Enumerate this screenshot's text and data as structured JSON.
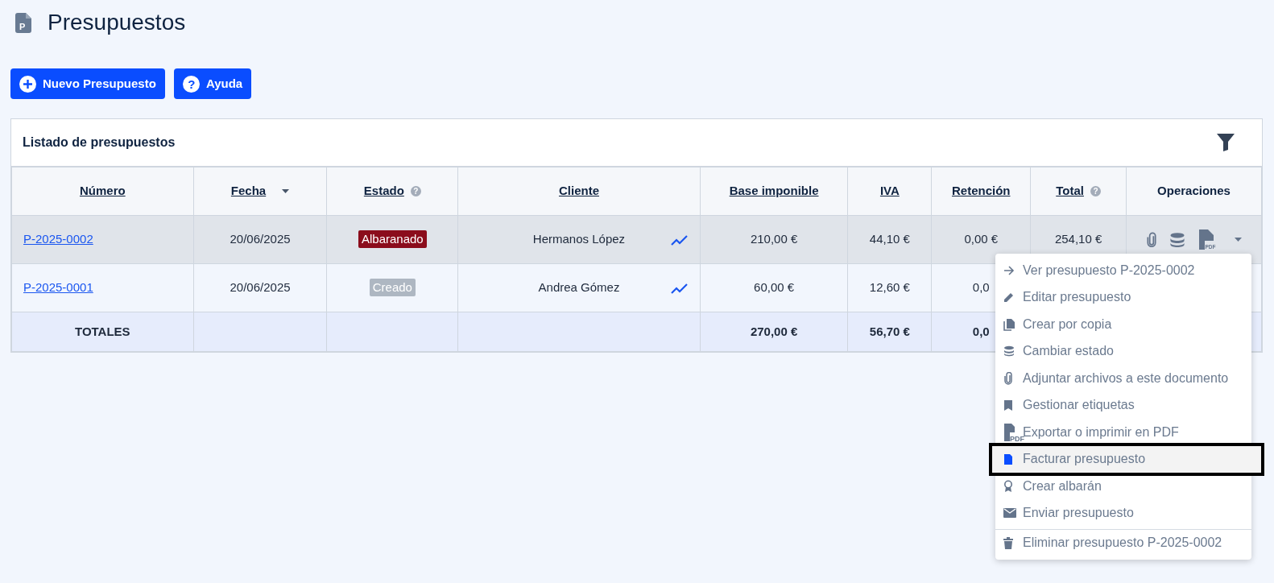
{
  "page": {
    "title": "Presupuestos",
    "icon_text": "P"
  },
  "buttons": [
    {
      "label": "Nuevo Presupuesto",
      "kind": "add"
    },
    {
      "label": "Ayuda",
      "kind": "help",
      "icon_text": "?"
    }
  ],
  "panel": {
    "title": "Listado de presupuestos"
  },
  "table": {
    "columns": [
      {
        "label": "Número",
        "sortable": true,
        "kind": "plain"
      },
      {
        "label": "Fecha",
        "sortable": true,
        "kind": "sort"
      },
      {
        "label": "Estado",
        "sortable": true,
        "kind": "help",
        "hint": "?"
      },
      {
        "label": "Cliente",
        "sortable": true,
        "kind": "plain"
      },
      {
        "label": "Base imponible",
        "sortable": true,
        "kind": "plain"
      },
      {
        "label": "IVA",
        "sortable": true,
        "kind": "plain"
      },
      {
        "label": "Retención",
        "sortable": true,
        "kind": "plain"
      },
      {
        "label": "Total",
        "sortable": true,
        "kind": "help",
        "hint": "?"
      },
      {
        "label": "Operaciones",
        "sortable": false,
        "kind": "plain"
      }
    ],
    "rows": [
      {
        "selected": true,
        "number": "P-2025-0002",
        "date": "20/06/2025",
        "status": {
          "label": "Albaranado",
          "color": "#8b0d1c"
        },
        "client": "Hermanos López",
        "base": "210,00 €",
        "iva": "44,10 €",
        "retention": "0,00 €",
        "total": "254,10 €",
        "operations": {
          "pdf_label": "PDF"
        }
      },
      {
        "selected": false,
        "number": "P-2025-0001",
        "date": "20/06/2025",
        "status": {
          "label": "Creado",
          "color": "#aeb7c2"
        },
        "client": "Andrea Gómez",
        "base": "60,00 €",
        "iva": "12,60 €",
        "retention": "0,0"
      }
    ],
    "totals": {
      "label": "TOTALES",
      "base": "270,00 €",
      "iva": "56,70 €",
      "retention": "0,0"
    }
  },
  "menu": {
    "items": [
      {
        "label": "Ver presupuesto P-2025-0002",
        "kind": "view",
        "selected": false,
        "divider_before": false
      },
      {
        "label": "Editar presupuesto",
        "kind": "edit",
        "selected": false,
        "divider_before": false
      },
      {
        "label": "Crear por copia",
        "kind": "copy",
        "selected": false,
        "divider_before": false
      },
      {
        "label": "Cambiar estado",
        "kind": "status",
        "selected": false,
        "divider_before": false
      },
      {
        "label": "Adjuntar archivos a este documento",
        "kind": "attach",
        "selected": false,
        "divider_before": false
      },
      {
        "label": "Gestionar etiquetas",
        "kind": "tags",
        "selected": false,
        "divider_before": false
      },
      {
        "label": "Exportar o imprimir en PDF",
        "kind": "export",
        "icon_text": "PDF",
        "selected": false,
        "divider_before": false
      },
      {
        "label": "Facturar presupuesto",
        "kind": "invoice",
        "selected": true,
        "divider_before": false
      },
      {
        "label": "Crear albarán",
        "kind": "delivery",
        "selected": false,
        "divider_before": false
      },
      {
        "label": "Enviar presupuesto",
        "kind": "send",
        "selected": false,
        "divider_before": false
      },
      {
        "label": "Eliminar presupuesto P-2025-0002",
        "kind": "delete",
        "selected": false,
        "divider_before": true
      }
    ]
  }
}
